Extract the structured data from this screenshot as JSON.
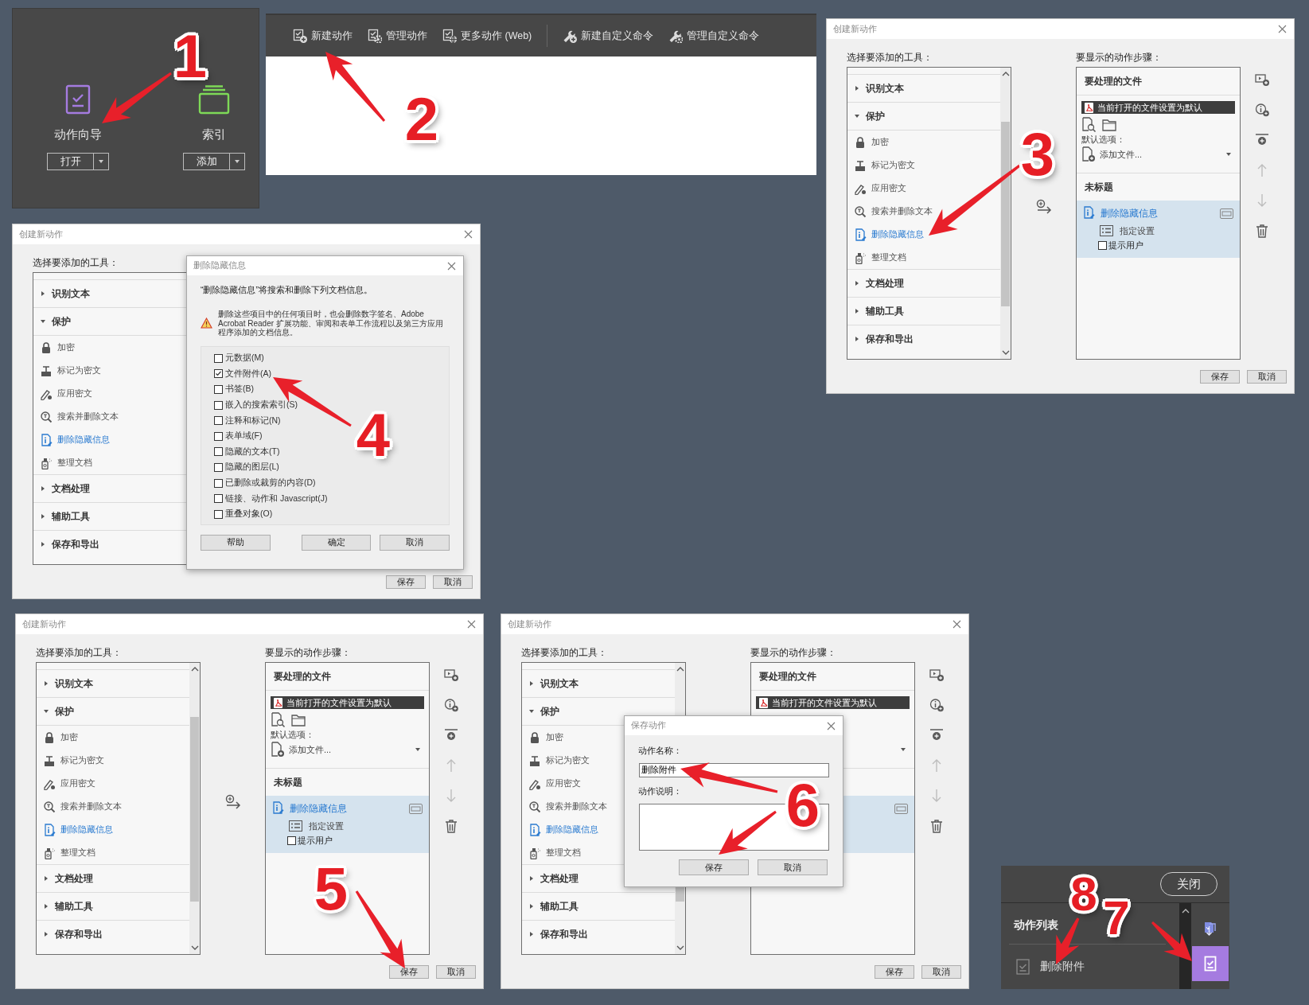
{
  "tools_panel": {
    "tools": [
      {
        "kind": "wizard",
        "label": "动作向导",
        "button": "打开"
      },
      {
        "kind": "index",
        "label": "索引",
        "button": "添加"
      }
    ]
  },
  "actions_toolbar": {
    "items": [
      {
        "kind": "new",
        "label": "新建动作"
      },
      {
        "kind": "manage",
        "label": "管理动作"
      },
      {
        "kind": "web",
        "label": "更多动作 (Web)"
      },
      {
        "kind": "separator"
      },
      {
        "kind": "new-command",
        "label": "新建自定义命令"
      },
      {
        "kind": "manage-command",
        "label": "管理自定义命令"
      }
    ]
  },
  "dialogs": [
    {
      "title": "创建新动作",
      "tools_label": "选择要添加的工具：",
      "tool_tree": [
        {
          "label": "识别文本",
          "expanded": false
        },
        {
          "label": "保护",
          "expanded": true,
          "children": [
            {
              "label": "加密",
              "kind": "lock",
              "selected": false
            },
            {
              "label": "标记为密文",
              "kind": "stamp",
              "selected": false
            },
            {
              "label": "应用密文",
              "kind": "pen",
              "selected": false
            },
            {
              "label": "搜索并删除文本",
              "kind": "search",
              "selected": false
            },
            {
              "label": "删除隐藏信息",
              "kind": "info",
              "selected": true
            },
            {
              "label": "整理文档",
              "kind": "spray",
              "selected": false
            }
          ]
        },
        {
          "label": "文档处理",
          "expanded": false
        },
        {
          "label": "辅助工具",
          "expanded": false
        },
        {
          "label": "保存和导出",
          "expanded": false
        }
      ],
      "steps_label": "要显示的动作步骤：",
      "steps_pane": {
        "source_header": "要处理的文件",
        "source_file": "当前打开的文件设置为默认",
        "default_label": "默认选项：",
        "add_files": "添加文件...",
        "group_header": "未标题",
        "steps": [
          {
            "label": "删除隐藏信息",
            "selected": true,
            "settings": "指定设置",
            "prompt": "提示用户",
            "prompt_checked": false
          }
        ]
      },
      "side_tools": [
        {
          "kind": "add-step",
          "disabled": false
        },
        {
          "kind": "add-info",
          "disabled": false
        },
        {
          "kind": "add-stop",
          "disabled": false
        },
        {
          "kind": "move-up",
          "disabled": true
        },
        {
          "kind": "move-down",
          "disabled": true
        },
        {
          "kind": "delete",
          "disabled": false
        }
      ],
      "buttons": [
        "保存",
        "取消"
      ]
    },
    {
      "title": "创建新动作",
      "tools_label": "选择要添加的工具：",
      "tool_tree": [
        {
          "label": "识别文本",
          "expanded": false
        },
        {
          "label": "保护",
          "expanded": true,
          "children": [
            {
              "label": "加密",
              "kind": "lock",
              "selected": false
            },
            {
              "label": "标记为密文",
              "kind": "stamp",
              "selected": false
            },
            {
              "label": "应用密文",
              "kind": "pen",
              "selected": false
            },
            {
              "label": "搜索并删除文本",
              "kind": "search",
              "selected": false
            },
            {
              "label": "删除隐藏信息",
              "kind": "info",
              "selected": true
            },
            {
              "label": "整理文档",
              "kind": "spray",
              "selected": false
            }
          ]
        },
        {
          "label": "文档处理",
          "expanded": false
        },
        {
          "label": "辅助工具",
          "expanded": false
        },
        {
          "label": "保存和导出",
          "expanded": false
        }
      ],
      "buttons": [
        "保存",
        "取消"
      ],
      "overlay": {
        "kind": "remove-hidden-info",
        "title": "删除隐藏信息",
        "intro": "“删除隐藏信息”将搜索和删除下列文档信息。",
        "warning": "删除这些项目中的任何项目时，也会删除数字签名、Adobe Acrobat Reader 扩展功能、审阅和表单工作流程以及第三方应用程序添加的文档信息。",
        "options": [
          {
            "label": "元数据(M)",
            "checked": false
          },
          {
            "label": "文件附件(A)",
            "checked": true
          },
          {
            "label": "书签(B)",
            "checked": false
          },
          {
            "label": "嵌入的搜索索引(S)",
            "checked": false
          },
          {
            "label": "注释和标记(N)",
            "checked": false
          },
          {
            "label": "表单域(F)",
            "checked": false
          },
          {
            "label": "隐藏的文本(T)",
            "checked": false
          },
          {
            "label": "隐藏的图层(L)",
            "checked": false
          },
          {
            "label": "已删除或裁剪的内容(D)",
            "checked": false
          },
          {
            "label": "链接、动作和 Javascript(J)",
            "checked": false
          },
          {
            "label": "重叠对象(O)",
            "checked": false
          }
        ],
        "buttons": [
          "帮助",
          "确定",
          "取消"
        ]
      }
    },
    {
      "title": "创建新动作",
      "tools_label": "选择要添加的工具：",
      "tool_tree": [
        {
          "label": "识别文本",
          "expanded": false
        },
        {
          "label": "保护",
          "expanded": true,
          "children": [
            {
              "label": "加密",
              "kind": "lock",
              "selected": false
            },
            {
              "label": "标记为密文",
              "kind": "stamp",
              "selected": false
            },
            {
              "label": "应用密文",
              "kind": "pen",
              "selected": false
            },
            {
              "label": "搜索并删除文本",
              "kind": "search",
              "selected": false
            },
            {
              "label": "删除隐藏信息",
              "kind": "info",
              "selected": true
            },
            {
              "label": "整理文档",
              "kind": "spray",
              "selected": false
            }
          ]
        },
        {
          "label": "文档处理",
          "expanded": false
        },
        {
          "label": "辅助工具",
          "expanded": false
        },
        {
          "label": "保存和导出",
          "expanded": false
        }
      ],
      "steps_label": "要显示的动作步骤：",
      "steps_pane": {
        "source_header": "要处理的文件",
        "source_file": "当前打开的文件设置为默认",
        "default_label": "默认选项：",
        "add_files": "添加文件...",
        "group_header": "未标题",
        "steps": [
          {
            "label": "删除隐藏信息",
            "selected": true,
            "settings": "指定设置",
            "prompt": "提示用户",
            "prompt_checked": false
          }
        ]
      },
      "side_tools": [
        {
          "kind": "add-step",
          "disabled": false
        },
        {
          "kind": "add-info",
          "disabled": false
        },
        {
          "kind": "add-stop",
          "disabled": false
        },
        {
          "kind": "move-up",
          "disabled": true
        },
        {
          "kind": "move-down",
          "disabled": true
        },
        {
          "kind": "delete",
          "disabled": false
        }
      ],
      "buttons": [
        "保存",
        "取消"
      ]
    },
    {
      "title": "创建新动作",
      "tools_label": "选择要添加的工具：",
      "tool_tree": [
        {
          "label": "识别文本",
          "expanded": false
        },
        {
          "label": "保护",
          "expanded": true,
          "children": [
            {
              "label": "加密",
              "kind": "lock",
              "selected": false
            },
            {
              "label": "标记为密文",
              "kind": "stamp",
              "selected": false
            },
            {
              "label": "应用密文",
              "kind": "pen",
              "selected": false
            },
            {
              "label": "搜索并删除文本",
              "kind": "search",
              "selected": false
            },
            {
              "label": "删除隐藏信息",
              "kind": "info",
              "selected": true
            },
            {
              "label": "整理文档",
              "kind": "spray",
              "selected": false
            }
          ]
        },
        {
          "label": "文档处理",
          "expanded": false
        },
        {
          "label": "辅助工具",
          "expanded": false
        },
        {
          "label": "保存和导出",
          "expanded": false
        }
      ],
      "steps_label": "要显示的动作步骤：",
      "steps_pane": {
        "source_header": "要处理的文件",
        "source_file": "当前打开的文件设置为默认",
        "steps": [
          {
            "selected": true
          }
        ]
      },
      "side_tools": [
        {
          "kind": "add-step",
          "disabled": false
        },
        {
          "kind": "add-info",
          "disabled": false
        },
        {
          "kind": "add-stop",
          "disabled": false
        },
        {
          "kind": "move-up",
          "disabled": true
        },
        {
          "kind": "move-down",
          "disabled": true
        },
        {
          "kind": "delete",
          "disabled": false
        }
      ],
      "buttons": [
        "保存",
        "取消"
      ],
      "overlay": {
        "kind": "save-action",
        "title": "保存动作",
        "name_label": "动作名称：",
        "name_value": "删除附件",
        "description_label": "动作说明：",
        "buttons": [
          "保存",
          "取消"
        ]
      }
    }
  ],
  "action_panel": {
    "close": "关闭",
    "list_title": "动作列表",
    "actions": [
      {
        "label": "删除附件"
      }
    ],
    "side_tools": [
      {
        "kind": "export",
        "selected": false
      },
      {
        "kind": "action-wizard",
        "selected": true
      }
    ]
  },
  "step_markers": [
    {
      "label": "1"
    },
    {
      "label": "2"
    },
    {
      "label": "3"
    },
    {
      "label": "4"
    },
    {
      "label": "5"
    },
    {
      "label": "6"
    },
    {
      "label": "7"
    },
    {
      "label": "8"
    }
  ]
}
